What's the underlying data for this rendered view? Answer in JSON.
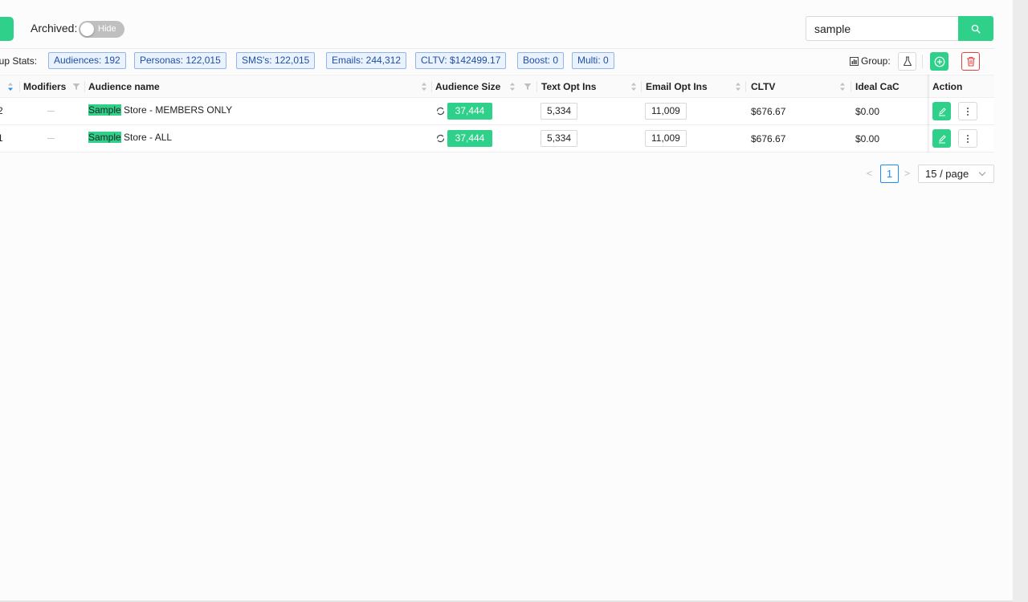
{
  "toolbar": {
    "archived_label": "Archived:",
    "archived_toggle": "Hide",
    "search_value": "sample"
  },
  "stats": {
    "label": "oup Stats:",
    "items": [
      "Audiences: 192",
      "Personas: 122,015",
      "SMS's: 122,015",
      "Emails: 244,312",
      "CLTV: $142499.17",
      "Boost: 0",
      "Multi: 0"
    ],
    "group_label": "Group:"
  },
  "table": {
    "columns": {
      "modifiers": "Modifiers",
      "audience_name": "Audience name",
      "audience_size": "Audience Size",
      "text_opt_ins": "Text Opt Ins",
      "email_opt_ins": "Email Opt Ins",
      "cltv": "CLTV",
      "ideal_cac": "Ideal CaC",
      "action": "Action"
    },
    "rows": [
      {
        "id_partial": "2",
        "name_highlight": "Sample",
        "name_rest": " Store - MEMBERS ONLY",
        "size": "37,444",
        "text_opt_ins": "5,334",
        "email_opt_ins": "11,009",
        "cltv": "$676.67",
        "ideal_cac": "$0.00"
      },
      {
        "id_partial": "1",
        "name_highlight": "Sample",
        "name_rest": " Store - ALL",
        "size": "37,444",
        "text_opt_ins": "5,334",
        "email_opt_ins": "11,009",
        "cltv": "$676.67",
        "ideal_cac": "$0.00"
      }
    ]
  },
  "pagination": {
    "prev": "<",
    "current_page": "1",
    "next": ">",
    "page_size": "15 / page"
  },
  "colors": {
    "accent_green": "#2fd08a",
    "tag_blue_border": "#91b5e8",
    "tag_blue_bg": "#e9f2fd",
    "delete_red": "#e84040",
    "pagination_blue": "#1890ff"
  }
}
